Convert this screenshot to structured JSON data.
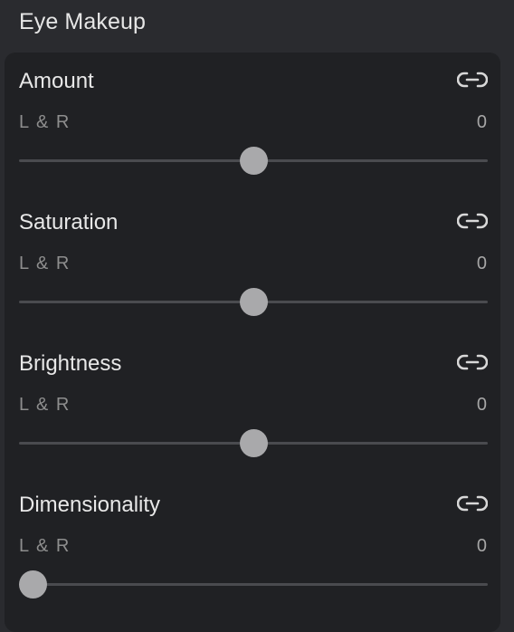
{
  "panel": {
    "title": "Eye Makeup"
  },
  "controls": [
    {
      "label": "Amount",
      "sublabel": "L & R",
      "value": "0",
      "position": 0.5,
      "icon": "link-icon"
    },
    {
      "label": "Saturation",
      "sublabel": "L & R",
      "value": "0",
      "position": 0.5,
      "icon": "link-icon"
    },
    {
      "label": "Brightness",
      "sublabel": "L & R",
      "value": "0",
      "position": 0.5,
      "icon": "link-icon"
    },
    {
      "label": "Dimensionality",
      "sublabel": "L & R",
      "value": "0",
      "position": 0.0,
      "icon": "link-icon"
    }
  ],
  "colors": {
    "background": "#2a2b2f",
    "card": "#202124",
    "thumb": "#a9a9ab",
    "track": "#4a4b4f"
  }
}
